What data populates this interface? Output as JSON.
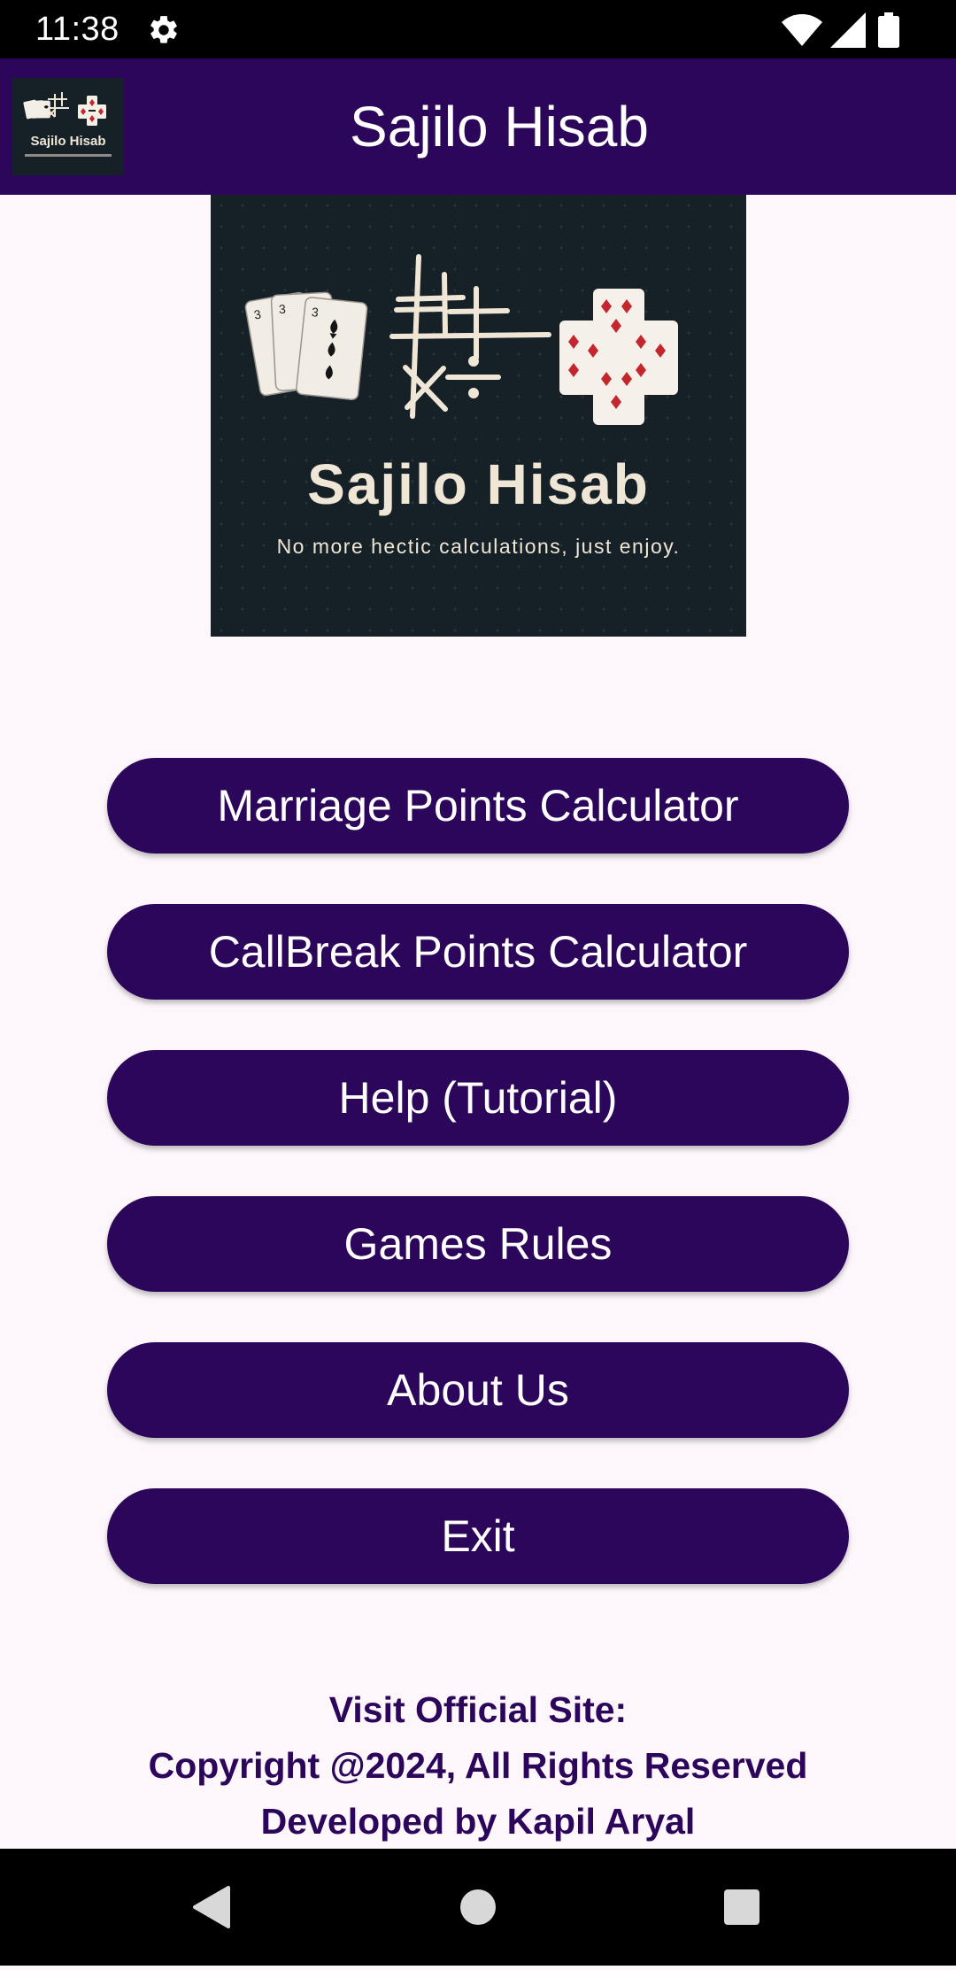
{
  "status_bar": {
    "time": "11:38",
    "icons": [
      "gear-icon",
      "wifi-icon",
      "signal-icon",
      "battery-icon"
    ]
  },
  "app_bar": {
    "title": "Sajilo Hisab",
    "logo_text": "Sajilo Hisab",
    "color": "#2c065b"
  },
  "banner": {
    "title": "Sajilo Hisab",
    "tagline": "No more hectic calculations, just enjoy."
  },
  "menu": {
    "buttons": [
      {
        "label": "Marriage Points Calculator"
      },
      {
        "label": "CallBreak Points Calculator"
      },
      {
        "label": "Help (Tutorial)"
      },
      {
        "label": "Games Rules"
      },
      {
        "label": "About Us"
      },
      {
        "label": "Exit"
      }
    ]
  },
  "footer": {
    "official_site": "Visit Official Site:",
    "copyright": "Copyright @2024, All Rights Reserved",
    "developer": "Developed by Kapil Aryal"
  },
  "nav_bar": {
    "icons": [
      "back-icon",
      "home-icon",
      "recents-icon"
    ]
  }
}
